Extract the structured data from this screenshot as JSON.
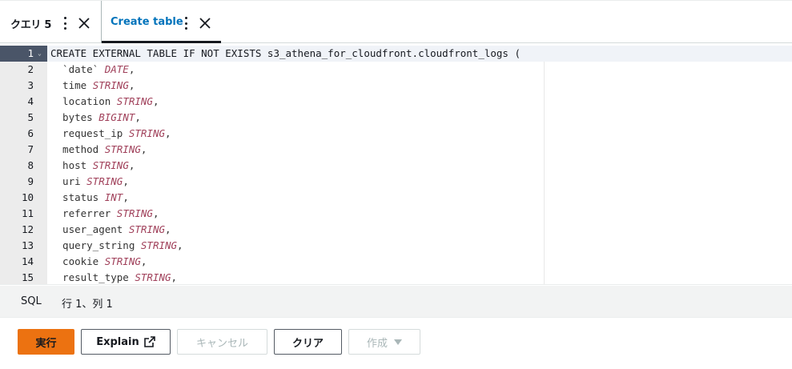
{
  "tabs": [
    {
      "label": "クエリ 5"
    },
    {
      "label": "Create table"
    }
  ],
  "editor": {
    "lines": [
      {
        "num": "1",
        "parts": [
          {
            "t": "CREATE EXTERNAL TABLE IF NOT EXISTS s3_athena_for_cloudfront.cloudfront_logs (",
            "c": "kw"
          }
        ]
      },
      {
        "num": "2",
        "parts": [
          {
            "t": "  `date` ",
            "c": ""
          },
          {
            "t": "DATE",
            "c": "type"
          },
          {
            "t": ",",
            "c": ""
          }
        ]
      },
      {
        "num": "3",
        "parts": [
          {
            "t": "  time ",
            "c": ""
          },
          {
            "t": "STRING",
            "c": "type"
          },
          {
            "t": ",",
            "c": ""
          }
        ]
      },
      {
        "num": "4",
        "parts": [
          {
            "t": "  location ",
            "c": ""
          },
          {
            "t": "STRING",
            "c": "type"
          },
          {
            "t": ",",
            "c": ""
          }
        ]
      },
      {
        "num": "5",
        "parts": [
          {
            "t": "  bytes ",
            "c": ""
          },
          {
            "t": "BIGINT",
            "c": "type"
          },
          {
            "t": ",",
            "c": ""
          }
        ]
      },
      {
        "num": "6",
        "parts": [
          {
            "t": "  request_ip ",
            "c": ""
          },
          {
            "t": "STRING",
            "c": "type"
          },
          {
            "t": ",",
            "c": ""
          }
        ]
      },
      {
        "num": "7",
        "parts": [
          {
            "t": "  method ",
            "c": ""
          },
          {
            "t": "STRING",
            "c": "type"
          },
          {
            "t": ",",
            "c": ""
          }
        ]
      },
      {
        "num": "8",
        "parts": [
          {
            "t": "  host ",
            "c": ""
          },
          {
            "t": "STRING",
            "c": "type"
          },
          {
            "t": ",",
            "c": ""
          }
        ]
      },
      {
        "num": "9",
        "parts": [
          {
            "t": "  uri ",
            "c": ""
          },
          {
            "t": "STRING",
            "c": "type"
          },
          {
            "t": ",",
            "c": ""
          }
        ]
      },
      {
        "num": "10",
        "parts": [
          {
            "t": "  status ",
            "c": ""
          },
          {
            "t": "INT",
            "c": "type"
          },
          {
            "t": ",",
            "c": ""
          }
        ]
      },
      {
        "num": "11",
        "parts": [
          {
            "t": "  referrer ",
            "c": ""
          },
          {
            "t": "STRING",
            "c": "type"
          },
          {
            "t": ",",
            "c": ""
          }
        ]
      },
      {
        "num": "12",
        "parts": [
          {
            "t": "  user_agent ",
            "c": ""
          },
          {
            "t": "STRING",
            "c": "type"
          },
          {
            "t": ",",
            "c": ""
          }
        ]
      },
      {
        "num": "13",
        "parts": [
          {
            "t": "  query_string ",
            "c": ""
          },
          {
            "t": "STRING",
            "c": "type"
          },
          {
            "t": ",",
            "c": ""
          }
        ]
      },
      {
        "num": "14",
        "parts": [
          {
            "t": "  cookie ",
            "c": ""
          },
          {
            "t": "STRING",
            "c": "type"
          },
          {
            "t": ",",
            "c": ""
          }
        ]
      },
      {
        "num": "15",
        "parts": [
          {
            "t": "  result_type ",
            "c": ""
          },
          {
            "t": "STRING",
            "c": "type"
          },
          {
            "t": ",",
            "c": ""
          }
        ]
      }
    ],
    "active_line": "1"
  },
  "status": {
    "language": "SQL",
    "position": "行 1、列 1"
  },
  "buttons": {
    "run": "実行",
    "explain": "Explain",
    "cancel": "キャンセル",
    "clear": "クリア",
    "create": "作成"
  },
  "icons": {
    "kebab": "kebab-menu-icon",
    "close": "close-icon",
    "external": "external-link-icon",
    "caret": "caret-down-icon"
  },
  "colors": {
    "accent": "#0073bb",
    "run_button": "#ec7211",
    "type_keyword": "#a0405a"
  }
}
